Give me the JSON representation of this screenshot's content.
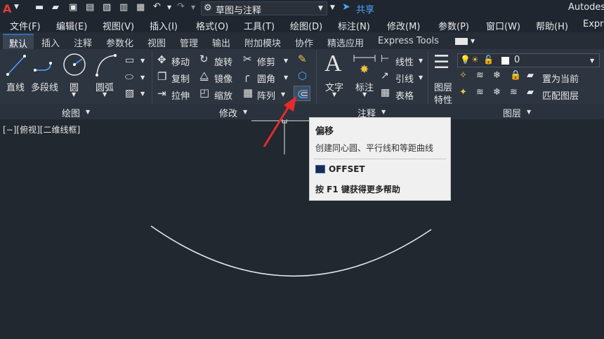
{
  "titlebar": {
    "workspace": "草图与注释",
    "share": "共享",
    "app": "Autodes"
  },
  "menu": [
    "文件(F)",
    "编辑(E)",
    "视图(V)",
    "插入(I)",
    "格式(O)",
    "工具(T)",
    "绘图(D)",
    "标注(N)",
    "修改(M)",
    "参数(P)",
    "窗口(W)",
    "帮助(H)",
    "Expr"
  ],
  "tabs": [
    "默认",
    "插入",
    "注释",
    "参数化",
    "视图",
    "管理",
    "输出",
    "附加模块",
    "协作",
    "精选应用",
    "Express Tools"
  ],
  "ribbon": {
    "draw": {
      "line": "直线",
      "polyline": "多段线",
      "circle": "圆",
      "arc": "圆弧",
      "panel": "绘图"
    },
    "modify": {
      "move": "移动",
      "rotate": "旋转",
      "trim": "修剪",
      "copy": "复制",
      "mirror": "镜像",
      "fillet": "圆角",
      "stretch": "拉伸",
      "scale": "缩放",
      "array": "阵列",
      "panel": "修改"
    },
    "annotation": {
      "text": "文字",
      "dimension": "标注",
      "linetype": "线性",
      "leader": "引线",
      "table": "表格",
      "panel": "注释"
    },
    "layers": {
      "layer_props_1": "图层",
      "layer_props_2": "特性",
      "current_layer": "0",
      "make_current": "置为当前",
      "match_layer": "匹配图层",
      "panel": "图层"
    }
  },
  "viewport": {
    "label": "[−][俯视][二维线框]"
  },
  "tooltip": {
    "title": "偏移",
    "desc": "创建同心圆、平行线和等距曲线",
    "command": "OFFSET",
    "help": "按 F1 键获得更多帮助"
  },
  "colors": {
    "ribbon": "#2d3540",
    "canvas": "#212830",
    "accent": "#2e6db4",
    "arrow": "#e52b2b",
    "tooltip_bg": "#f0f0f0"
  }
}
